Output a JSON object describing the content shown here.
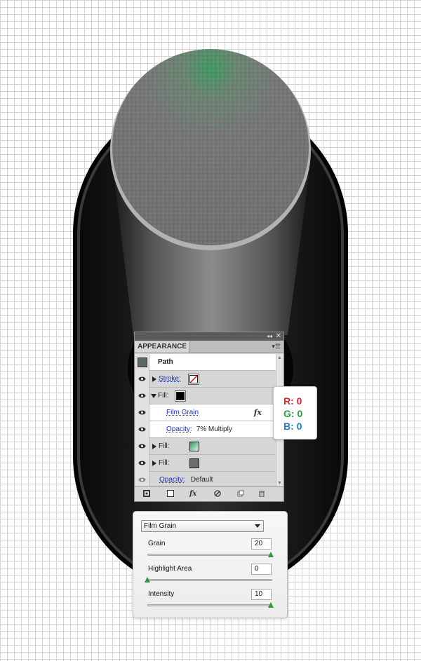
{
  "panel": {
    "title": "APPEARANCE",
    "collapse_glyph": "◂◂",
    "close_glyph": "✕",
    "menu_glyph": "▾☰",
    "object_label": "Path",
    "rows": [
      {
        "label": "Stroke:",
        "type": "stroke",
        "swatch": "none"
      },
      {
        "label": "Fill:",
        "type": "fill",
        "swatch_color": "#000000"
      },
      {
        "label": "Film Grain",
        "type": "effect",
        "icon": "fx-icon"
      },
      {
        "label": "Opacity:",
        "value": "7% Multiply",
        "type": "opacity"
      },
      {
        "label": "Fill:",
        "type": "fill",
        "swatch": "green-gradient"
      },
      {
        "label": "Fill:",
        "type": "fill",
        "swatch_color": "#6e6e6e"
      },
      {
        "label": "Opacity:",
        "value": "Default",
        "type": "opacity"
      }
    ],
    "bottom_icons": [
      "add-new-stroke-icon",
      "add-new-fill-icon",
      "add-new-effect-icon",
      "clear-appearance-icon",
      "duplicate-item-icon",
      "delete-item-icon"
    ],
    "fx_glyph": "fx"
  },
  "rgb": {
    "r": "R: 0",
    "g": "G: 0",
    "b": "B: 0",
    "r_color": "#e0282e",
    "g_color": "#2f9a3c",
    "b_color": "#2a7bc0"
  },
  "film_grain": {
    "effect": "Film Grain",
    "grain_label": "Grain",
    "grain_value": "20",
    "grain_level": 0.99,
    "highlight_label": "Highlight Area",
    "highlight_value": "0",
    "highlight_level": 0.0,
    "intensity_label": "Intensity",
    "intensity_value": "10",
    "intensity_level": 0.99
  }
}
